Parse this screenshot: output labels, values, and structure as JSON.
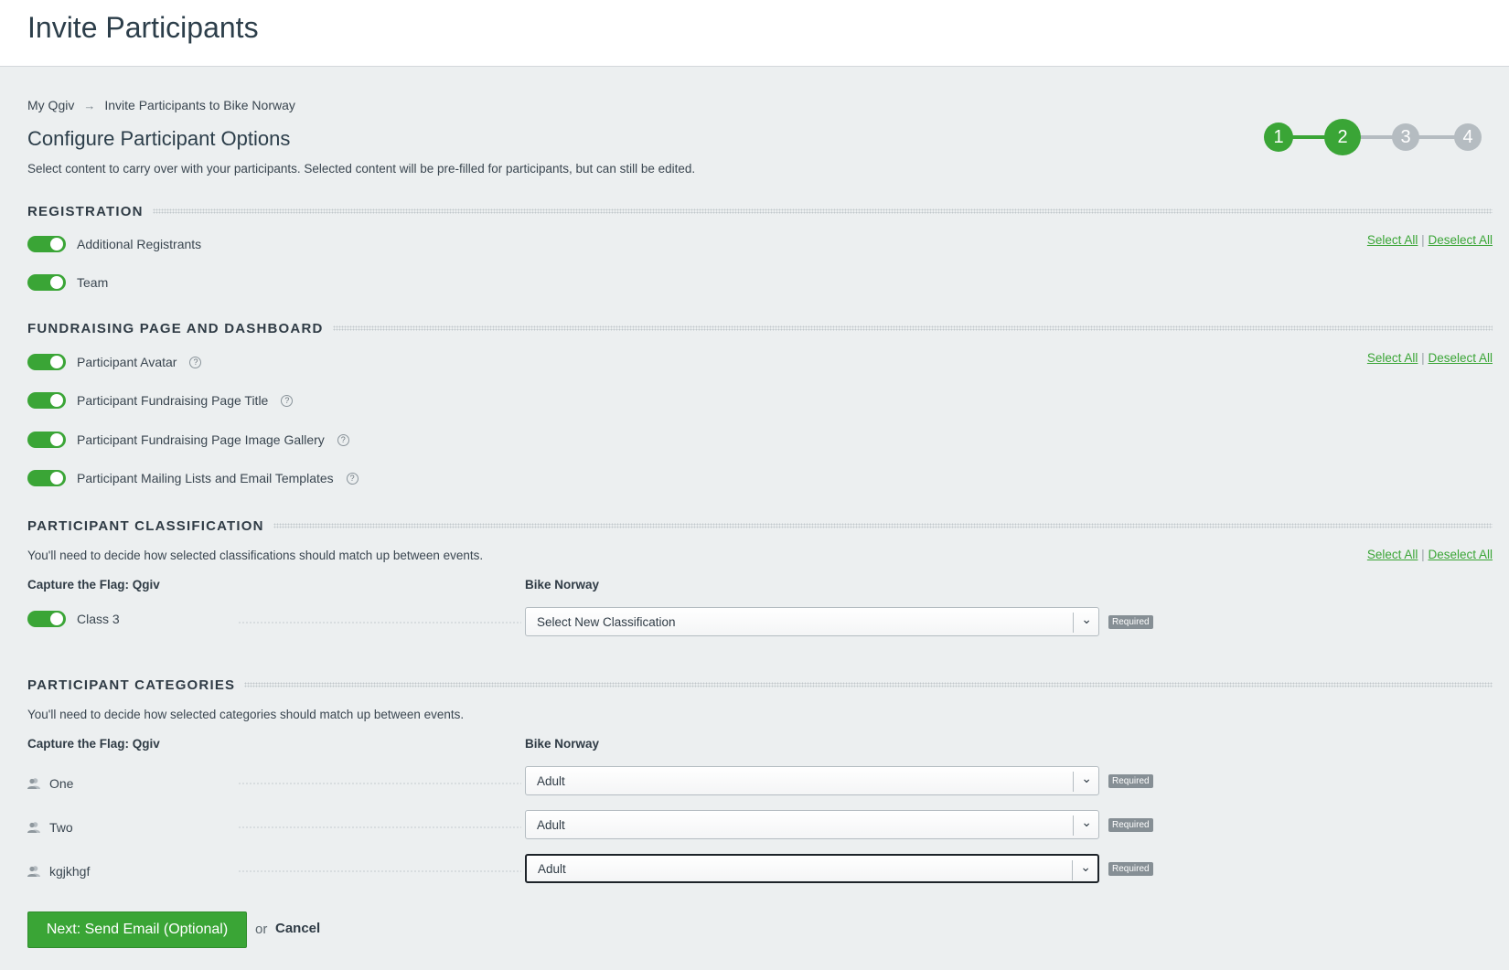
{
  "header": {
    "title": "Invite Participants"
  },
  "breadcrumb": {
    "home": "My Qgiv",
    "current": "Invite Participants to Bike Norway"
  },
  "main": {
    "heading": "Configure Participant Options",
    "intro": "Select content to carry over with your participants. Selected content will be pre-filled for participants, but can still be edited."
  },
  "stepper": {
    "steps": [
      "1",
      "2",
      "3",
      "4"
    ],
    "completed_color": "#3aa536",
    "pending_color": "#b5bcc1"
  },
  "links": {
    "select_all": "Select All",
    "separator": "|",
    "deselect_all": "Deselect All"
  },
  "registration": {
    "title": "REGISTRATION",
    "items": [
      "Additional Registrants",
      "Team"
    ]
  },
  "fundraising": {
    "title": "FUNDRAISING PAGE AND DASHBOARD",
    "items": [
      "Participant Avatar",
      "Participant Fundraising Page Title",
      "Participant Fundraising Page Image Gallery",
      "Participant Mailing Lists and Email Templates"
    ],
    "help_glyph": "?"
  },
  "classification": {
    "title": "PARTICIPANT CLASSIFICATION",
    "description": "You'll need to decide how selected classifications should match up between events.",
    "source_col": "Capture the Flag: Qgiv",
    "target_col": "Bike Norway",
    "rows": [
      {
        "label": "Class 3",
        "select": "Select New Classification",
        "badge": "Required"
      }
    ]
  },
  "categories": {
    "title": "PARTICIPANT CATEGORIES",
    "description": "You'll need to decide how selected categories should match up between events.",
    "source_col": "Capture the Flag: Qgiv",
    "target_col": "Bike Norway",
    "rows": [
      {
        "label": "One",
        "select": "Adult",
        "badge": "Required"
      },
      {
        "label": "Two",
        "select": "Adult",
        "badge": "Required"
      },
      {
        "label": "kgjkhgf",
        "select": "Adult",
        "badge": "Required"
      }
    ]
  },
  "footer": {
    "next_label": "Next: Send Email (Optional)",
    "or_text": "or",
    "cancel_label": "Cancel"
  },
  "icons": {
    "arrow": "→",
    "chevron": "⌄",
    "person": "person-icon"
  },
  "colors": {
    "accent": "#3aa536",
    "background": "#eceff0",
    "text": "#2f3b45"
  }
}
